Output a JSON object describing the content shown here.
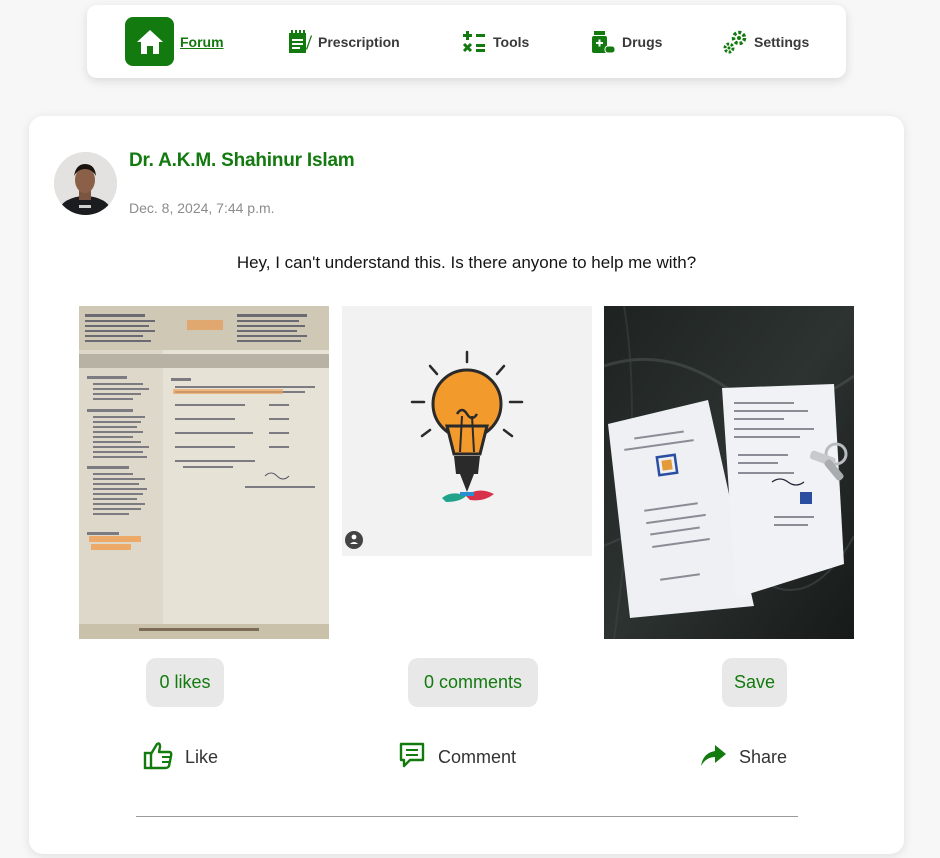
{
  "nav": {
    "items": [
      {
        "label": "Forum",
        "icon": "home-icon",
        "active": true
      },
      {
        "label": "Prescription",
        "icon": "prescription-icon"
      },
      {
        "label": "Tools",
        "icon": "calculator-icon"
      },
      {
        "label": "Drugs",
        "icon": "drugs-icon"
      },
      {
        "label": "Settings",
        "icon": "gear-icon"
      }
    ]
  },
  "post": {
    "author": "Dr. A.K.M. Shahinur Islam",
    "timestamp": "Dec. 8, 2024, 7:44 p.m.",
    "text": "Hey, I can't understand this. Is there anyone to help me with?",
    "stats": {
      "likes": "0 likes",
      "comments": "0 comments",
      "save": "Save"
    },
    "actions": {
      "like": "Like",
      "comment": "Comment",
      "share": "Share"
    }
  },
  "colors": {
    "accent": "#137a0f",
    "button_bg": "#e8e8e8"
  }
}
